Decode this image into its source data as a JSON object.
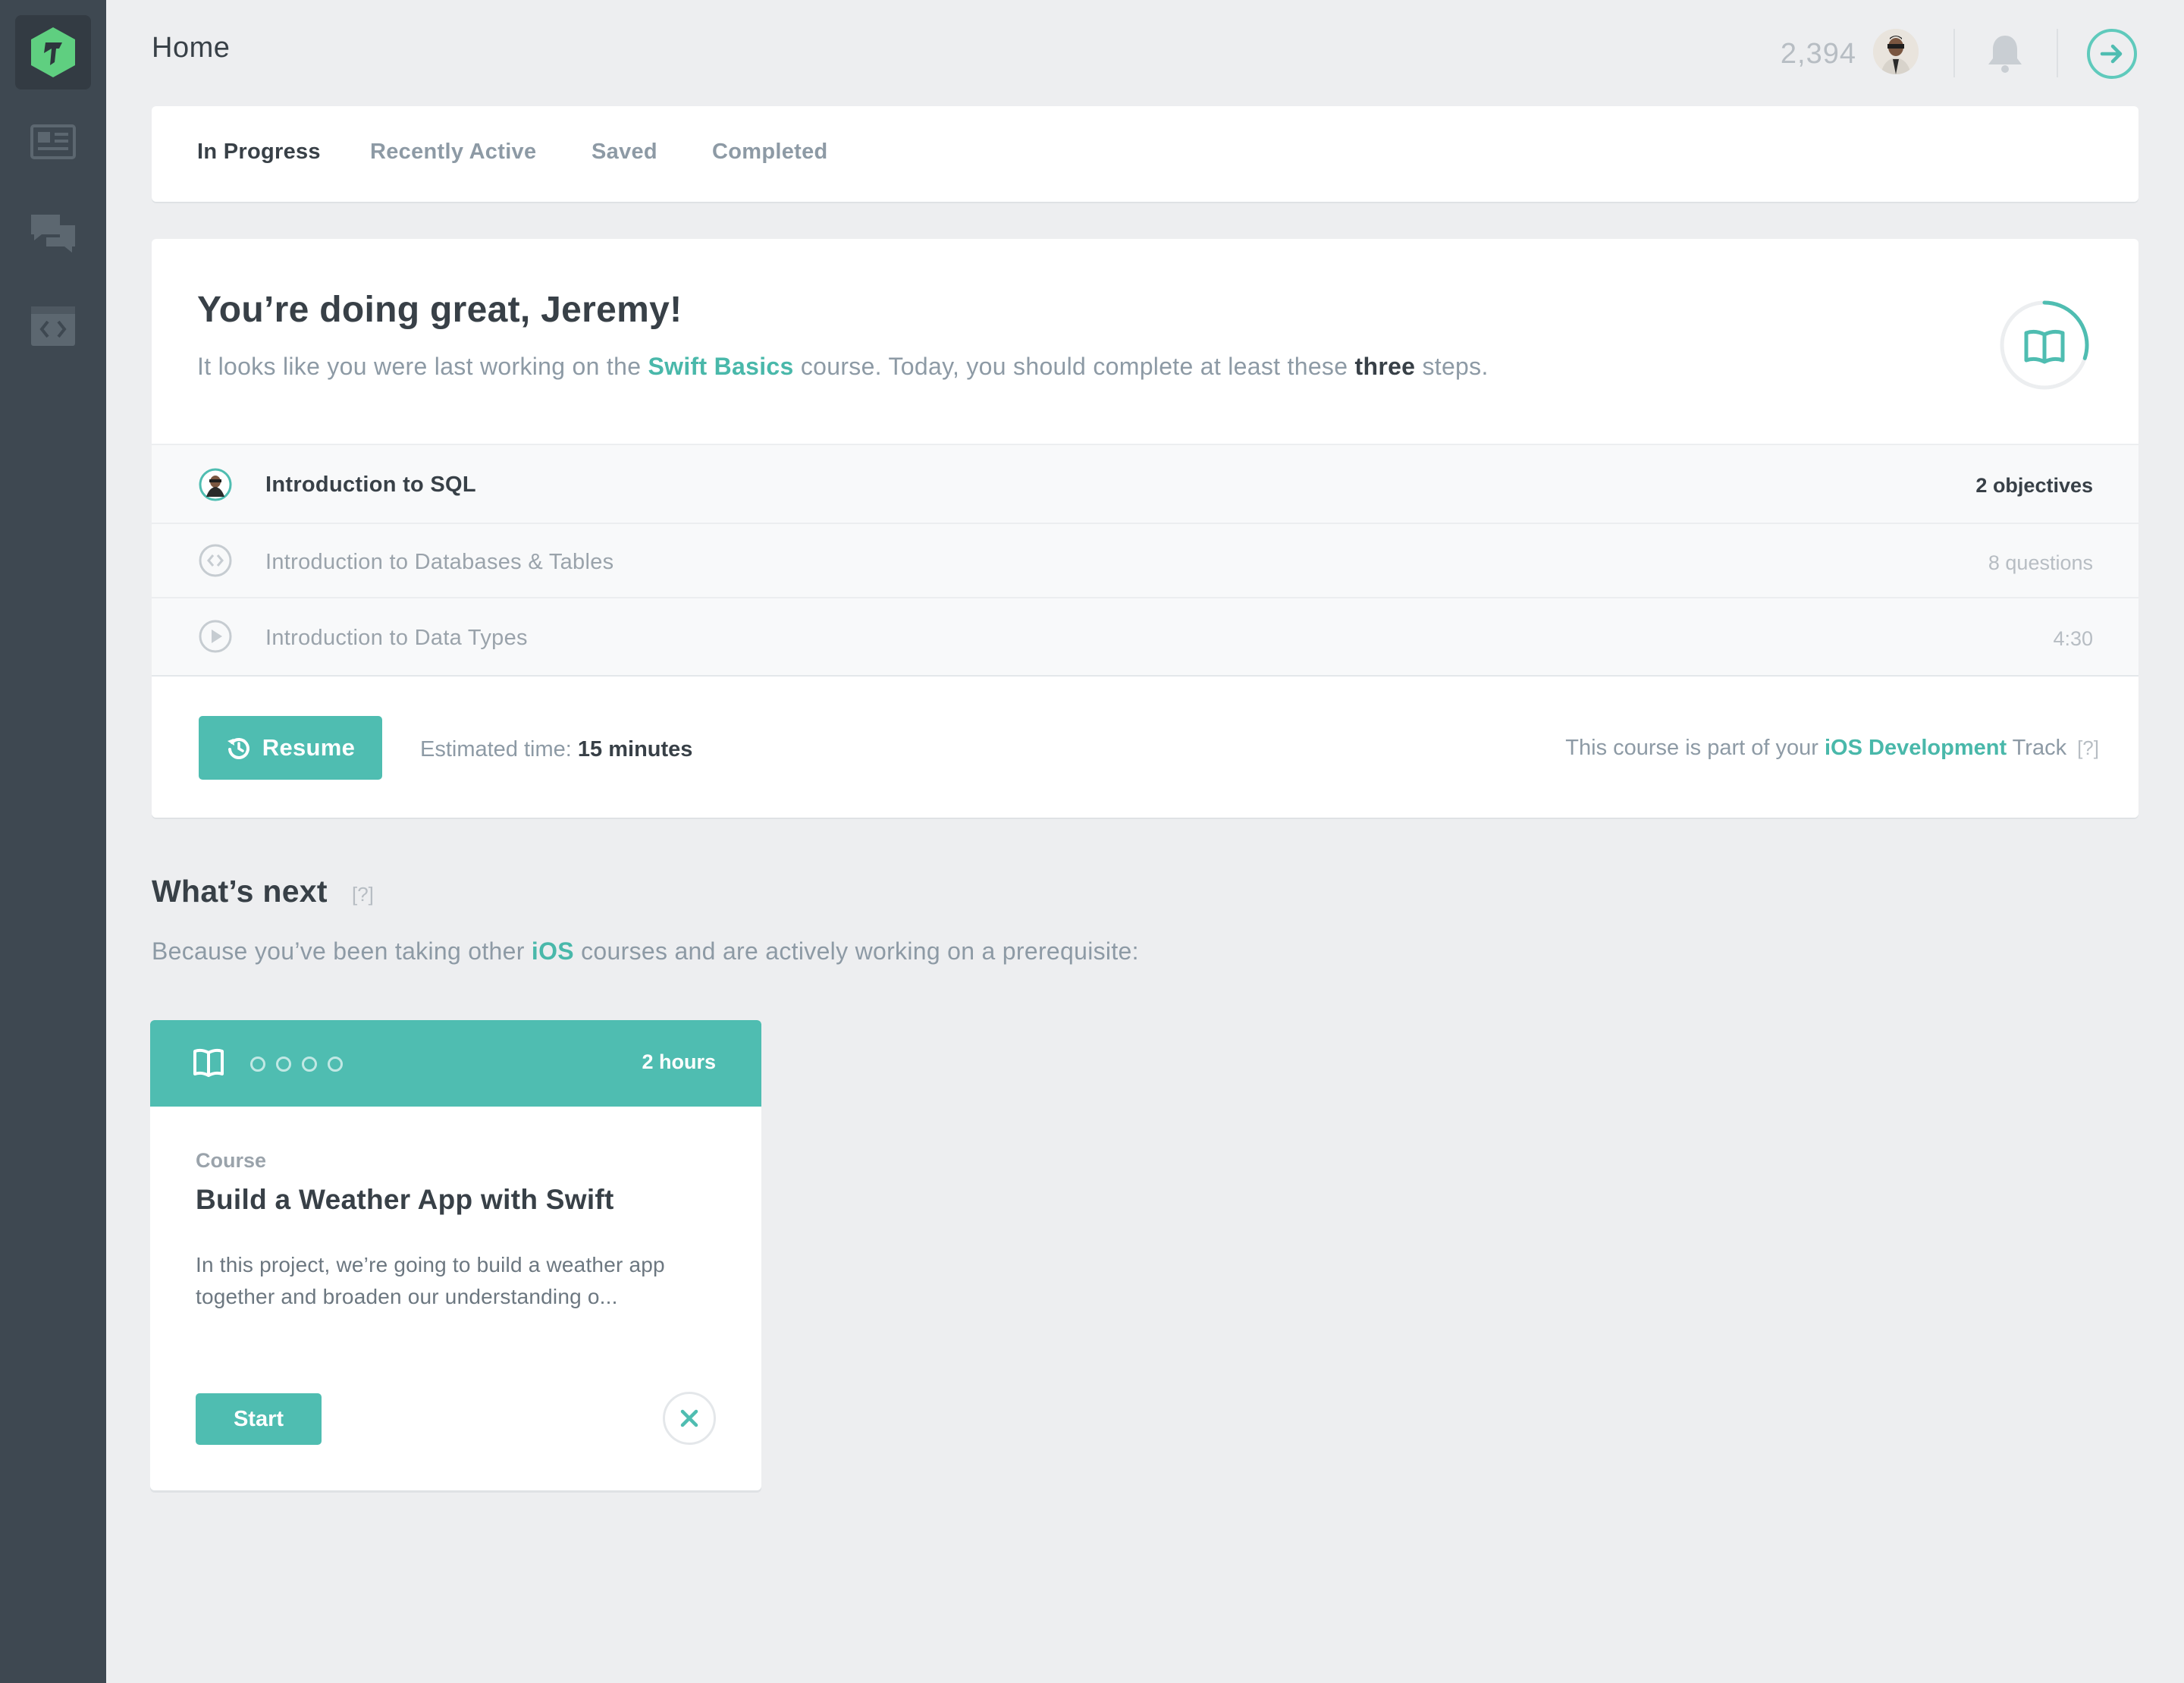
{
  "header": {
    "title": "Home",
    "points": "2,394"
  },
  "sidebar": {
    "items": [
      {
        "icon": "logo-icon"
      },
      {
        "icon": "library-icon"
      },
      {
        "icon": "community-icon"
      },
      {
        "icon": "workspaces-icon"
      }
    ]
  },
  "tabs": [
    {
      "label": "In Progress",
      "active": true
    },
    {
      "label": "Recently Active",
      "active": false
    },
    {
      "label": "Saved",
      "active": false
    },
    {
      "label": "Completed",
      "active": false
    }
  ],
  "progress_card": {
    "greeting": "You’re doing great, Jeremy!",
    "intro_pre": "It looks like you were last working on the ",
    "course_name": "Swift Basics",
    "intro_mid": " course. Today, you should complete at least these ",
    "step_count_word": "three",
    "intro_post": " steps.",
    "progress_fraction": 0.3,
    "steps": [
      {
        "title": "Introduction to SQL",
        "meta": "2 objectives",
        "icon": "avatar-icon",
        "current": true
      },
      {
        "title": "Introduction to Databases & Tables",
        "meta": "8 questions",
        "icon": "code-challenge-icon",
        "current": false
      },
      {
        "title": "Introduction to Data Types",
        "meta": "4:30",
        "icon": "play-video-icon",
        "current": false
      }
    ],
    "resume_label": "Resume",
    "estimated_label": "Estimated time: ",
    "estimated_value": "15 minutes",
    "track_pre": "This course is part of your ",
    "track_name": "iOS Development",
    "track_post": " Track",
    "help": "[?]"
  },
  "whats_next": {
    "title": "What’s next",
    "help": "[?]",
    "desc_pre": "Because you’ve been taking other ",
    "desc_accent": "iOS",
    "desc_post": " courses and are actively working on a prerequisite:"
  },
  "course_card": {
    "duration": "2 hours",
    "type": "Course",
    "title": "Build a Weather App with Swift",
    "description": "In this project, we’re going to build a weather app together and broaden our understanding o...",
    "start_label": "Start",
    "difficulty_dots": 4
  },
  "colors": {
    "accent": "#4fbdb1",
    "sidebar": "#3e4851",
    "logo_green": "#5fcf80",
    "background": "#edeef0"
  }
}
